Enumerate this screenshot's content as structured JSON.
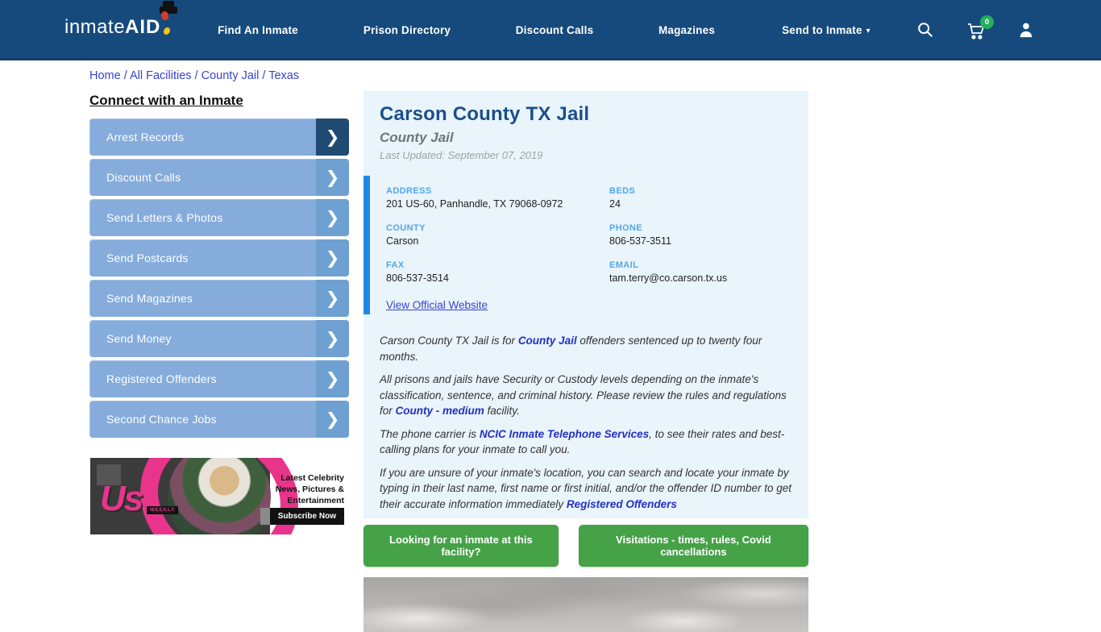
{
  "nav": {
    "logo_inmate": "inmate",
    "logo_aid": "AID",
    "items": [
      {
        "label": "Find An Inmate"
      },
      {
        "label": "Prison Directory"
      },
      {
        "label": "Discount Calls"
      },
      {
        "label": "Magazines"
      },
      {
        "label": "Send to Inmate",
        "has_dropdown": true
      }
    ],
    "cart_count": "0"
  },
  "icons": {
    "chevron_right": "❯",
    "caret_down": "▾"
  },
  "breadcrumb": {
    "items": [
      "Home",
      "All Facilities",
      "County Jail",
      "Texas"
    ],
    "separator": " / "
  },
  "sidebar": {
    "heading": "Connect with an Inmate",
    "items": [
      {
        "label": "Arrest Records"
      },
      {
        "label": "Discount Calls"
      },
      {
        "label": "Send Letters & Photos"
      },
      {
        "label": "Send Postcards"
      },
      {
        "label": "Send Magazines"
      },
      {
        "label": "Send Money"
      },
      {
        "label": "Registered Offenders"
      },
      {
        "label": "Second Chance Jobs"
      }
    ]
  },
  "ad": {
    "logo": "Us",
    "logo_sub": "WEEKLY",
    "headline": "Latest Celebrity News, Pictures & Entertainment",
    "cta": "Subscribe Now"
  },
  "main": {
    "title": "Carson County TX Jail",
    "subtitle": "County Jail",
    "last_updated": "Last Updated: September 07, 2019",
    "info": {
      "address_label": "ADDRESS",
      "address": "201 US-60, Panhandle, TX 79068-0972",
      "beds_label": "BEDS",
      "beds": "24",
      "county_label": "COUNTY",
      "county": "Carson",
      "phone_label": "PHONE",
      "phone": "806-537-3511",
      "fax_label": "FAX",
      "fax": "806-537-3514",
      "email_label": "EMAIL",
      "email": "tam.terry@co.carson.tx.us",
      "website_link": "View Official Website"
    },
    "paragraphs": [
      {
        "pre": "Carson County TX Jail is for ",
        "link": "County Jail",
        "post": " offenders sentenced up to twenty four months."
      },
      {
        "pre": "All prisons and jails have Security or Custody levels depending on the inmate's classification, sentence, and criminal history. Please review the rules and regulations for ",
        "link": "County - medium",
        "post": " facility."
      },
      {
        "pre": "The phone carrier is ",
        "link": "NCIC Inmate Telephone Services",
        "post": ", to see their rates and best-calling plans for your inmate to call you."
      },
      {
        "pre": "If you are unsure of your inmate's location, you can search and locate your inmate by typing in their last name, first name or first initial, and/or the offender ID number to get their accurate information immediately ",
        "link": "Registered Offenders",
        "post": ""
      }
    ],
    "buttons": [
      {
        "label": "Looking for an inmate at this facility?"
      },
      {
        "label": "Visitations - times, rules, Covid cancellations"
      }
    ]
  },
  "colors": {
    "nav_bg": "#164A7C",
    "panel_bg": "#E9F4FB",
    "title_blue": "#1B4F8A",
    "accent_bar": "#1E88E5",
    "label_blue": "#53A7E8",
    "link_blue": "#3643D4",
    "bold_link": "#2430C4",
    "sidebar_btn": "#85ACDB",
    "sidebar_arrow": "#6FA0D2",
    "sidebar_first_arrow": "#1F4B72",
    "green_btn": "#45A247",
    "badge_green": "#27AE60",
    "ad_pink": "#E9348C",
    "ad_dark": "#3B3B3B"
  }
}
